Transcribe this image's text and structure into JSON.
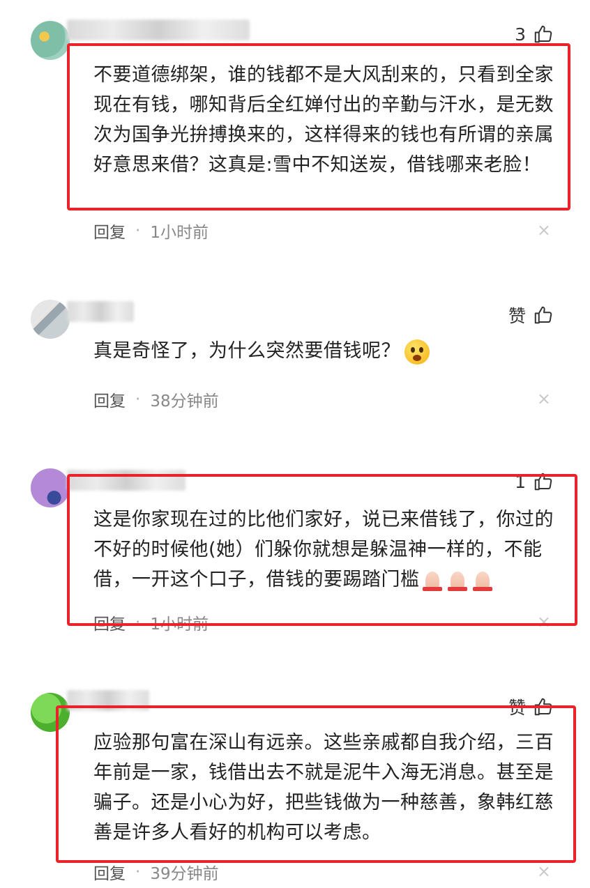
{
  "comments": [
    {
      "like_label": "3",
      "text": "不要道德绑架，谁的钱都不是大风刮来的，只看到全家现在有钱，哪知背后全红婵付出的辛勤与汗水，是无数次为国争光拚搏换来的，这样得来的钱也有所谓的亲属好意思来借？这真是:雪中不知送炭，借钱哪来老脸！",
      "reply_label": "回复",
      "separator": "·",
      "time": "1小时前",
      "close_glyph": "×"
    },
    {
      "like_label": "赞",
      "text": "真是奇怪了，为什么突然要借钱呢？",
      "reply_label": "回复",
      "separator": "·",
      "time": "38分钟前",
      "close_glyph": "×"
    },
    {
      "like_label": "1",
      "text": "这是你家现在过的比他们家好，说已来借钱了，你过的不好的时候他(她）们躲你就想是躲温神一样的，不能借，一开这个口子，借钱的要踢踏门槛",
      "reply_label": "回复",
      "separator": "·",
      "time": "1小时前",
      "close_glyph": "×"
    },
    {
      "like_label": "赞",
      "text": "应验那句富在深山有远亲。这些亲戚都自我介绍，三百年前是一家，钱借出去不就是泥牛入海无消息。甚至是骗子。还是小心为好，把些钱做为一种慈善，象韩红慈善是许多人看好的机构可以考虑。",
      "reply_label": "回复",
      "separator": "·",
      "time": "39分钟前",
      "close_glyph": "×"
    }
  ],
  "colors": {
    "highlight_box": "#e8232a",
    "text": "#222222",
    "meta": "#888888"
  }
}
